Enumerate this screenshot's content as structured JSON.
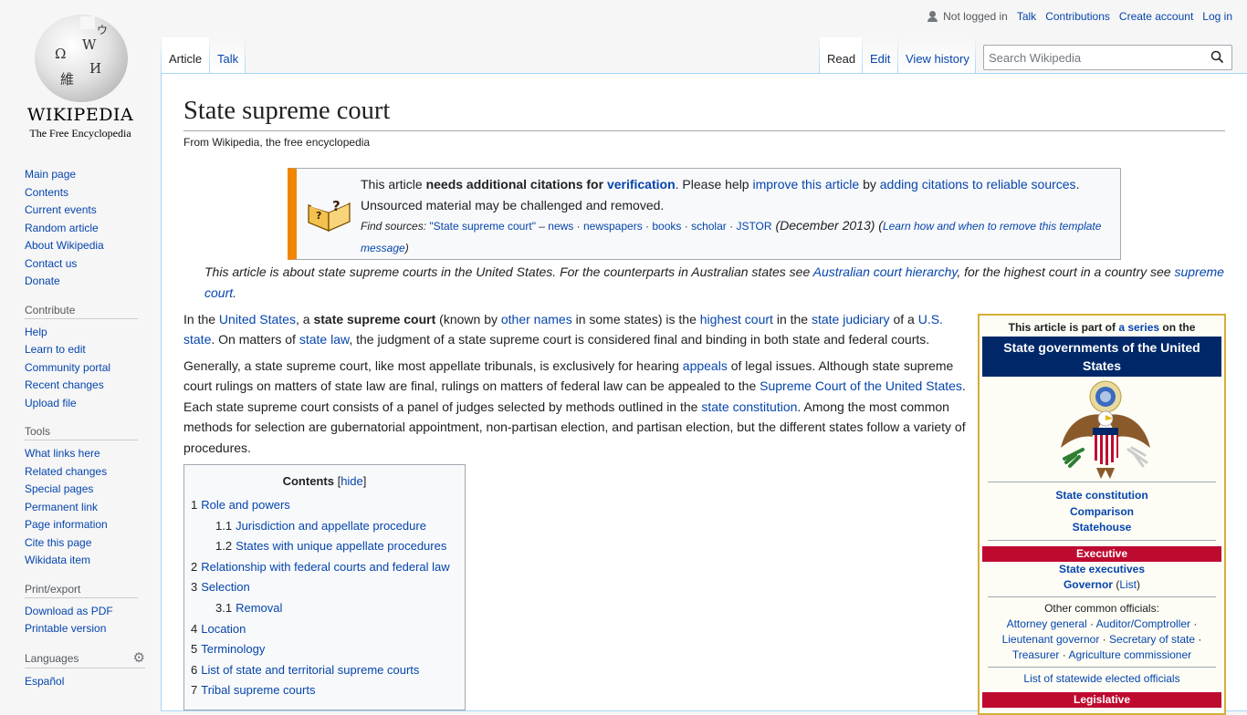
{
  "logo": {
    "wordmark": "Wikipedia",
    "tagline": "The Free Encyclopedia"
  },
  "personal": {
    "status": "Not logged in",
    "talk": "Talk",
    "contributions": "Contributions",
    "create": "Create account",
    "login": "Log in"
  },
  "tabs": {
    "article": "Article",
    "talk": "Talk",
    "read": "Read",
    "edit": "Edit",
    "history": "View history"
  },
  "search": {
    "placeholder": "Search Wikipedia"
  },
  "nav": {
    "main": [
      "Main page",
      "Contents",
      "Current events",
      "Random article",
      "About Wikipedia",
      "Contact us",
      "Donate"
    ],
    "contribute_heading": "Contribute",
    "contribute": [
      "Help",
      "Learn to edit",
      "Community portal",
      "Recent changes",
      "Upload file"
    ],
    "tools_heading": "Tools",
    "tools": [
      "What links here",
      "Related changes",
      "Special pages",
      "Permanent link",
      "Page information",
      "Cite this page",
      "Wikidata item"
    ],
    "print_heading": "Print/export",
    "print": [
      "Download as PDF",
      "Printable version"
    ],
    "languages_heading": "Languages",
    "languages": [
      "Español"
    ]
  },
  "article": {
    "title": "State supreme court",
    "tagline": "From Wikipedia, the free encyclopedia",
    "ambox": {
      "t1": "This article ",
      "t2": "needs additional citations for ",
      "t3": "verification",
      "t4": ". Please help ",
      "t5": "improve this article",
      "t6": " by ",
      "t7": "adding citations to reliable sources",
      "t8": ".",
      "t9": "Unsourced material may be challenged and removed.",
      "fs_label": "Find sources: ",
      "fs_query": "\"State supreme court\"",
      "fs_dash": " – ",
      "fs_news": "news",
      "fs_newspapers": "newspapers",
      "fs_books": "books",
      "fs_scholar": "scholar",
      "fs_jstor": "JSTOR",
      "fs_dot": " · ",
      "date": " (December 2013) (",
      "learn": "Learn how and when to remove this template message",
      "close": ")"
    },
    "hatnote": {
      "h1": "This article is about state supreme courts in the United States. For the counterparts in Australian states see ",
      "h2": "Australian court hierarchy",
      "h3": ", for the highest court in a country see ",
      "h4": "supreme court",
      "h5": "."
    },
    "p1": {
      "a": "In the ",
      "b": "United States",
      "c": ", a ",
      "d": "state supreme court",
      "e": " (known by ",
      "f": "other names",
      "g": " in some states) is the ",
      "h": "highest court",
      "i": " in the ",
      "j": "state judiciary",
      "k": " of a ",
      "l": "U.S. state",
      "m": ". On matters of ",
      "n": "state law",
      "o": ", the judgment of a state supreme court is considered final and binding in both state and federal courts."
    },
    "p2": {
      "a": "Generally, a state supreme court, like most appellate tribunals, is exclusively for hearing ",
      "b": "appeals",
      "c": " of legal issues. Although state supreme court rulings on matters of state law are final, rulings on matters of federal law can be appealed to the ",
      "d": "Supreme Court of the United States",
      "e": ". Each state supreme court consists of a panel of judges selected by methods outlined in the ",
      "f": "state constitution",
      "g": ". Among the most common methods for selection are gubernatorial appointment, non-partisan election, and partisan election, but the different states follow a variety of procedures."
    }
  },
  "toc": {
    "title": "Contents",
    "hide": "hide",
    "lb": "[",
    "rb": "]",
    "items": [
      {
        "num": "1",
        "text": "Role and powers"
      },
      {
        "num": "1.1",
        "text": "Jurisdiction and appellate procedure"
      },
      {
        "num": "1.2",
        "text": "States with unique appellate procedures"
      },
      {
        "num": "2",
        "text": "Relationship with federal courts and federal law"
      },
      {
        "num": "3",
        "text": "Selection"
      },
      {
        "num": "3.1",
        "text": "Removal"
      },
      {
        "num": "4",
        "text": "Location"
      },
      {
        "num": "5",
        "text": "Terminology"
      },
      {
        "num": "6",
        "text": "List of state and territorial supreme courts"
      },
      {
        "num": "7",
        "text": "Tribal supreme courts"
      }
    ]
  },
  "series": {
    "pre1": "This article is part of ",
    "pre2": "a series",
    "pre3": " on the",
    "title": "State governments of the United States",
    "links": [
      "State constitution",
      "Comparison",
      "Statehouse"
    ],
    "exec": "Executive",
    "exec1": "State executives",
    "gov": "Governor",
    "list": "List",
    "lp": " (",
    "rp": ")",
    "other": "Other common officials:",
    "o1": "Attorney general",
    "o2": "Auditor/Comptroller",
    "o3": "Lieutenant governor",
    "o4": "Secretary of state",
    "o5": "Treasurer",
    "o6": "Agriculture commissioner",
    "dot": " · ",
    "statewide": "List of statewide elected officials",
    "leg": "Legislative"
  },
  "colors": {
    "link": "#0645ad",
    "ambox_border": "#f28500",
    "series_header": "#002868",
    "series_section": "#bf0a30"
  }
}
